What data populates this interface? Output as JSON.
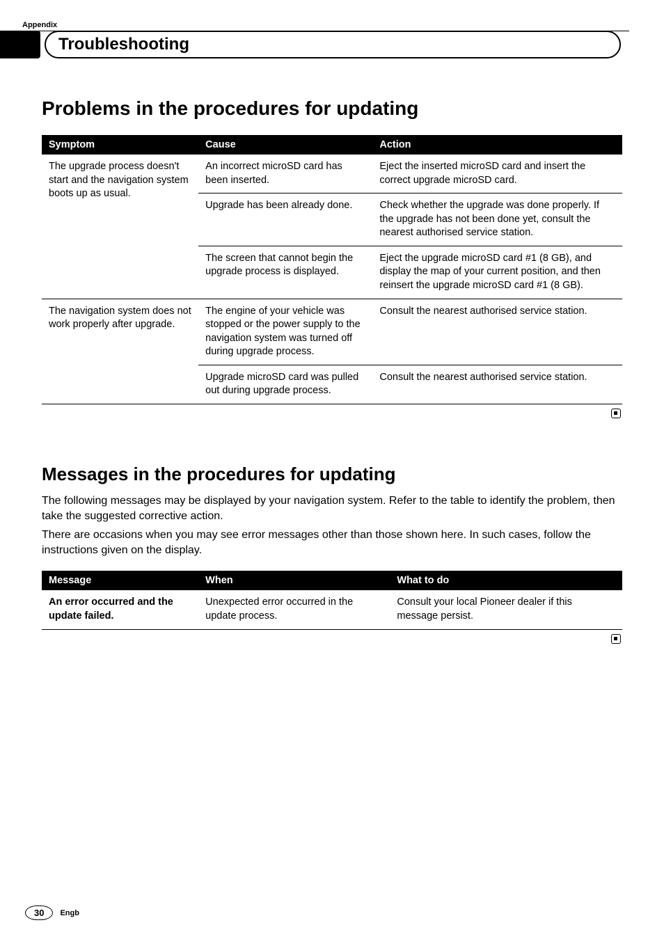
{
  "header": {
    "appendix": "Appendix",
    "section_title": "Troubleshooting"
  },
  "sections": {
    "problems": {
      "heading": "Problems in the procedures for updating",
      "table": {
        "headers": {
          "c1": "Symptom",
          "c2": "Cause",
          "c3": "Action"
        },
        "rows": [
          {
            "symptom": "The upgrade process doesn't start and the navigation system boots up as usual.",
            "symptom_rowspan": 3,
            "cause": "An incorrect microSD card has been inserted.",
            "action": "Eject the inserted microSD card and insert the correct upgrade microSD card."
          },
          {
            "cause": "Upgrade has been already done.",
            "action": "Check whether the upgrade was done properly. If the upgrade has not been done yet, consult the nearest authorised service station."
          },
          {
            "cause": "The screen that cannot begin the upgrade process is displayed.",
            "action": "Eject the upgrade microSD card #1 (8 GB), and display the map of your current position, and then reinsert the upgrade microSD card #1 (8 GB)."
          },
          {
            "symptom": "The navigation system does not work properly after upgrade.",
            "symptom_rowspan": 2,
            "cause": "The engine of your vehicle was stopped or the power supply to the navigation system was turned off during upgrade process.",
            "action": "Consult the nearest authorised service station."
          },
          {
            "cause": "Upgrade microSD card was pulled out during upgrade process.",
            "action": "Consult the nearest authorised service station."
          }
        ]
      }
    },
    "messages": {
      "heading": "Messages in the procedures for updating",
      "intro1": "The following messages may be displayed by your navigation system. Refer to the table to identify the problem, then take the suggested corrective action.",
      "intro2": "There are occasions when you may see error messages other than those shown here. In such cases, follow the instructions given on the display.",
      "table": {
        "headers": {
          "c1": "Message",
          "c2": "When",
          "c3": "What to do"
        },
        "rows": [
          {
            "message": "An error occurred and the update failed.",
            "when": "Unexpected error occurred in the update process.",
            "what": "Consult your local Pioneer dealer if this message persist."
          }
        ]
      }
    }
  },
  "footer": {
    "page_number": "30",
    "lang": "Engb"
  }
}
